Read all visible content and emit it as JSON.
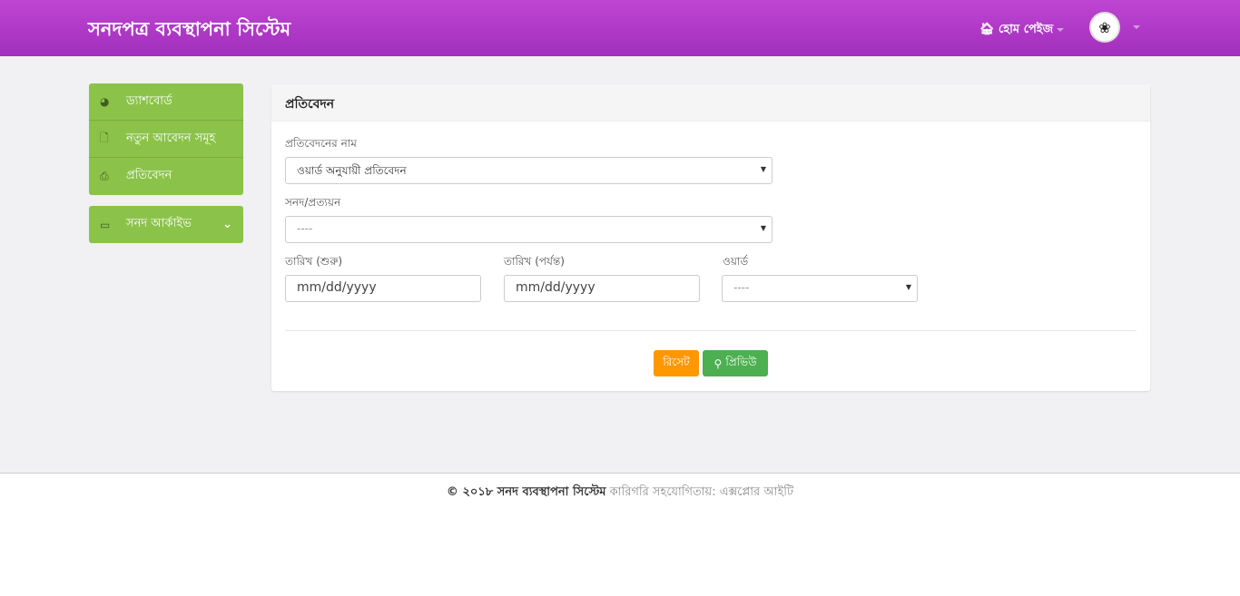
{
  "header": {
    "title": "সনদপত্র ব্যবস্থাপনা সিস্টেম",
    "home": "হোম পেইজ",
    "home_icon": "home-icon",
    "avatar_icon": "emblem"
  },
  "sidebar": {
    "items": [
      {
        "label": "ড্যাশবোর্ড",
        "icon": "dashboard-icon"
      },
      {
        "label": "নতুন আবেদন সমূহ",
        "icon": "file-icon"
      },
      {
        "label": "প্রতিবেদন",
        "icon": "print-icon"
      }
    ],
    "archive": {
      "label": "সনদ আর্কাইভ",
      "icon": "inbox-icon"
    }
  },
  "panel": {
    "title": "প্রতিবেদন",
    "report_name_label": "প্রতিবেদনের নাম",
    "report_name_value": "ওয়ার্ড অনুযায়ী প্রতিবেদন",
    "cert_label": "সনদ/প্রত্যয়ন",
    "cert_value": "----",
    "date_from_label": "তারিখ (শুরু)",
    "date_from_placeholder": "mm/dd/yyyy",
    "date_to_label": "তারিখ (পর্যন্ত)",
    "date_to_placeholder": "mm/dd/yyyy",
    "ward_label": "ওয়ার্ড",
    "ward_value": "----",
    "reset": "রিসেট",
    "preview": "প্রিভিউ"
  },
  "footer": {
    "bold": "© ২০১৮ সনদ ব্যবস্থাপনা সিস্টেম",
    "rest": "কারিগরি সহযোগিতায়: এক্সপ্লোর আইটি"
  },
  "colors": {
    "header": "#b03ac8",
    "sidebar": "#8bc34a",
    "reset": "#ff9800",
    "preview": "#4caf50"
  }
}
